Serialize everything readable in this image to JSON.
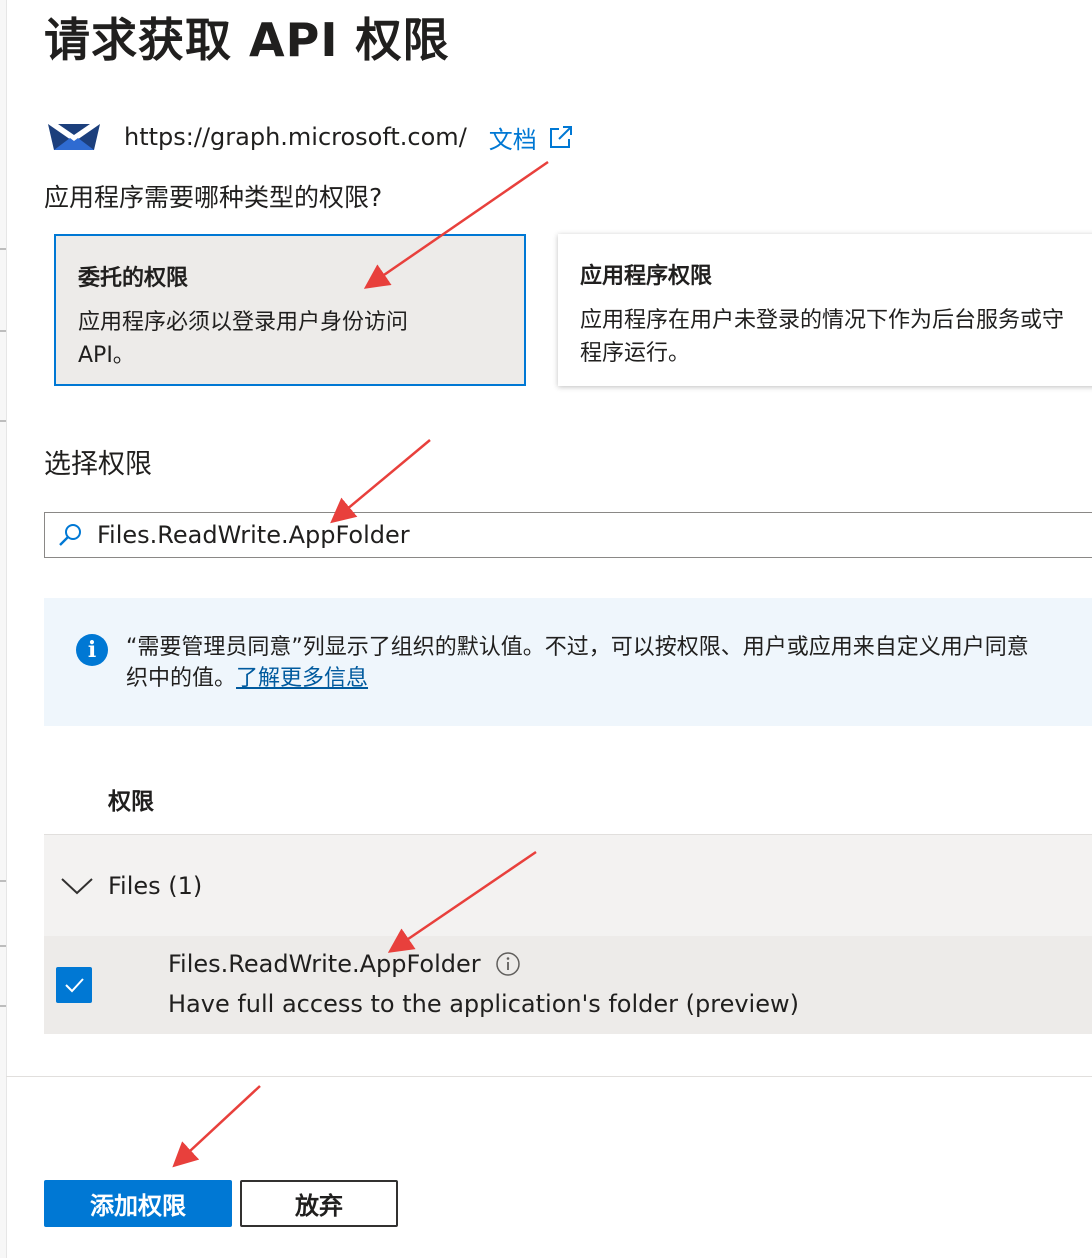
{
  "page": {
    "title": "请求获取 API 权限",
    "api_url": "https://graph.microsoft.com/",
    "doc_link": "文档",
    "question": "应用程序需要哪种类型的权限?"
  },
  "permission_types": {
    "delegated": {
      "title": "委托的权限",
      "description_line1": "应用程序必须以登录用户身份访问",
      "description_line2": "API。",
      "selected": true
    },
    "application": {
      "title": "应用程序权限",
      "description_line1": "应用程序在用户未登录的情况下作为后台服务或守",
      "description_line2": "程序运行。",
      "selected": false
    }
  },
  "select": {
    "label": "选择权限",
    "search_value": "Files.ReadWrite.AppFolder"
  },
  "info": {
    "line1": "“需要管理员同意”列显示了组织的默认值。不过，可以按权限、用户或应用来自定义用户同意",
    "line2": "织中的值。",
    "link": "了解更多信息"
  },
  "table": {
    "column_header": "权限",
    "group_label": "Files (1)",
    "permission": {
      "name": "Files.ReadWrite.AppFolder",
      "description": "Have full access to the application's folder (preview)",
      "checked": true
    }
  },
  "buttons": {
    "add": "添加权限",
    "discard": "放弃"
  },
  "colors": {
    "accent": "#0078d4",
    "annotation_arrow": "#e8403c"
  },
  "icons": {
    "api_logo": "graph-api-logo-icon",
    "external": "external-link-icon",
    "search": "search-icon",
    "info": "info-icon",
    "chevron": "chevron-down-icon",
    "checkbox": "checkmark-icon",
    "tooltip": "info-circle-icon"
  }
}
